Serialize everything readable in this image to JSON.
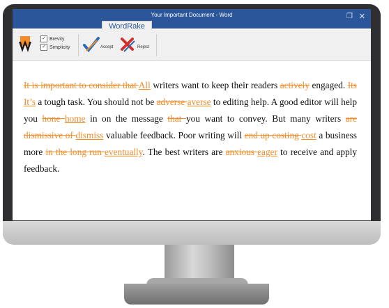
{
  "window": {
    "title": "Your Important Document - Word"
  },
  "ribbon": {
    "tab": "WordRake",
    "options": [
      {
        "label": "Brevity",
        "checked": true
      },
      {
        "label": "Simplicity",
        "checked": true
      }
    ],
    "accept_label": "Accept",
    "reject_label": "Reject"
  },
  "document": {
    "segments": [
      {
        "type": "del",
        "text": "It is important to consider that "
      },
      {
        "type": "ins",
        "text": "All"
      },
      {
        "type": "normal",
        "text": " writers want to keep their readers "
      },
      {
        "type": "del",
        "text": "actively"
      },
      {
        "type": "normal",
        "text": " engaged. "
      },
      {
        "type": "del",
        "text": "Its "
      },
      {
        "type": "ins",
        "text": "It’s"
      },
      {
        "type": "normal",
        "text": " a tough task. You should not be "
      },
      {
        "type": "del",
        "text": "adverse "
      },
      {
        "type": "ins",
        "text": "averse"
      },
      {
        "type": "normal",
        "text": " to editing help. A good editor will help you "
      },
      {
        "type": "del",
        "text": "hone "
      },
      {
        "type": "ins",
        "text": "home"
      },
      {
        "type": "normal",
        "text": " in on the message "
      },
      {
        "type": "del",
        "text": "that "
      },
      {
        "type": "normal",
        "text": "you want to convey. But many writers "
      },
      {
        "type": "del",
        "text": "are dismissive of "
      },
      {
        "type": "ins",
        "text": "dismiss"
      },
      {
        "type": "normal",
        "text": " valuable feedback. Poor writing will "
      },
      {
        "type": "del",
        "text": "end up costing "
      },
      {
        "type": "ins",
        "text": "cost"
      },
      {
        "type": "normal",
        "text": " a business more "
      },
      {
        "type": "del",
        "text": "in the long run "
      },
      {
        "type": "ins",
        "text": "eventually"
      },
      {
        "type": "normal",
        "text": ". The best writers are "
      },
      {
        "type": "del",
        "text": "anxious "
      },
      {
        "type": "ins",
        "text": "eager"
      },
      {
        "type": "normal",
        "text": " to receive and apply feedback."
      }
    ]
  },
  "colors": {
    "titlebar": "#2b579a",
    "tracked_change": "#f28c28"
  },
  "icons": [
    "wordrake-logo-icon",
    "accept-check-icon",
    "reject-x-icon",
    "restore-icon",
    "close-icon"
  ]
}
